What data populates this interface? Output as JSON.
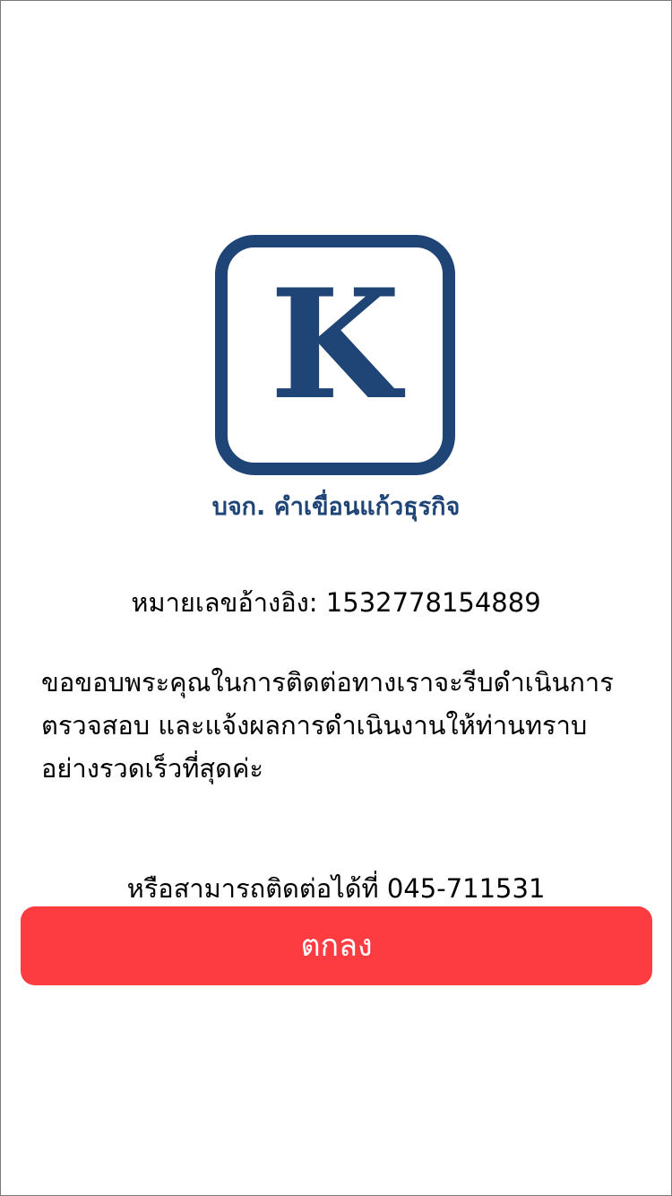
{
  "logo": {
    "letter": "K",
    "caption": "บจก. คำเขื่อนแก้วธุรกิจ",
    "color": "#1f4476"
  },
  "reference": {
    "text": "หมายเลขอ้างอิง: 1532778154889"
  },
  "message": {
    "text": "ขอขอบพระคุณในการติดต่อทางเราจะรีบดำเนินการ\nตรวจสอบ และแจ้งผลการดำเนินงานให้ท่านทราบ\nอย่างรวดเร็วที่สุดค่ะ"
  },
  "contact": {
    "text": "หรือสามารถติดต่อได้ที่ 045-711531"
  },
  "button": {
    "label": "ตกลง",
    "color": "#fc3c41"
  }
}
